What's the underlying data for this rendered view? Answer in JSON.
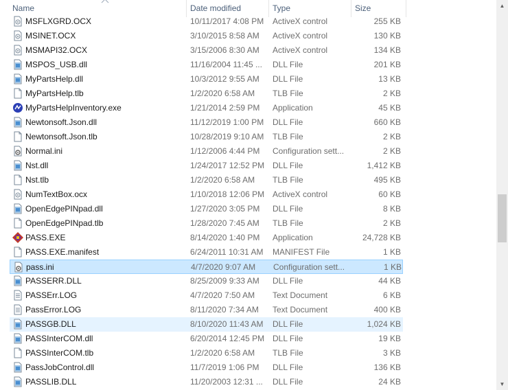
{
  "columns": {
    "name": "Name",
    "date_modified": "Date modified",
    "type": "Type",
    "size": "Size"
  },
  "files": [
    {
      "name": "MSFLXGRD.OCX",
      "date": "10/11/2017 4:08 PM",
      "type": "ActiveX control",
      "size": "255 KB",
      "icon": "ocx-file-icon"
    },
    {
      "name": "MSINET.OCX",
      "date": "3/10/2015 8:58 AM",
      "type": "ActiveX control",
      "size": "130 KB",
      "icon": "ocx-file-icon"
    },
    {
      "name": "MSMAPI32.OCX",
      "date": "3/15/2006 8:30 AM",
      "type": "ActiveX control",
      "size": "134 KB",
      "icon": "ocx-file-icon"
    },
    {
      "name": "MSPOS_USB.dll",
      "date": "11/16/2004 11:45 ...",
      "type": "DLL File",
      "size": "201 KB",
      "icon": "dll-file-icon"
    },
    {
      "name": "MyPartsHelp.dll",
      "date": "10/3/2012 9:55 AM",
      "type": "DLL File",
      "size": "13 KB",
      "icon": "dll-file-icon"
    },
    {
      "name": "MyPartsHelp.tlb",
      "date": "1/2/2020 6:58 AM",
      "type": "TLB File",
      "size": "2 KB",
      "icon": "blank-file-icon"
    },
    {
      "name": "MyPartsHelpInventory.exe",
      "date": "1/21/2014 2:59 PM",
      "type": "Application",
      "size": "45 KB",
      "icon": "app-exe-icon"
    },
    {
      "name": "Newtonsoft.Json.dll",
      "date": "11/12/2019 1:00 PM",
      "type": "DLL File",
      "size": "660 KB",
      "icon": "dll-file-icon"
    },
    {
      "name": "Newtonsoft.Json.tlb",
      "date": "10/28/2019 9:10 AM",
      "type": "TLB File",
      "size": "2 KB",
      "icon": "blank-file-icon"
    },
    {
      "name": "Normal.ini",
      "date": "1/12/2006 4:44 PM",
      "type": "Configuration sett...",
      "size": "2 KB",
      "icon": "ini-file-icon"
    },
    {
      "name": "Nst.dll",
      "date": "1/24/2017 12:52 PM",
      "type": "DLL File",
      "size": "1,412 KB",
      "icon": "dll-file-icon"
    },
    {
      "name": "Nst.tlb",
      "date": "1/2/2020 6:58 AM",
      "type": "TLB File",
      "size": "495 KB",
      "icon": "blank-file-icon"
    },
    {
      "name": "NumTextBox.ocx",
      "date": "1/10/2018 12:06 PM",
      "type": "ActiveX control",
      "size": "60 KB",
      "icon": "ocx-file-icon"
    },
    {
      "name": "OpenEdgePINpad.dll",
      "date": "1/27/2020 3:05 PM",
      "type": "DLL File",
      "size": "8 KB",
      "icon": "dll-file-icon"
    },
    {
      "name": "OpenEdgePINpad.tlb",
      "date": "1/28/2020 7:45 AM",
      "type": "TLB File",
      "size": "2 KB",
      "icon": "blank-file-icon"
    },
    {
      "name": "PASS.EXE",
      "date": "8/14/2020 1:40 PM",
      "type": "Application",
      "size": "24,728 KB",
      "icon": "pass-app-icon"
    },
    {
      "name": "PASS.EXE.manifest",
      "date": "6/24/2011 10:31 AM",
      "type": "MANIFEST File",
      "size": "1 KB",
      "icon": "blank-file-icon"
    },
    {
      "name": "pass.ini",
      "date": "4/7/2020 9:07 AM",
      "type": "Configuration sett...",
      "size": "1 KB",
      "icon": "ini-file-icon"
    },
    {
      "name": "PASSERR.DLL",
      "date": "8/25/2009 9:33 AM",
      "type": "DLL File",
      "size": "44 KB",
      "icon": "dll-file-icon"
    },
    {
      "name": "PASSErr.LOG",
      "date": "4/7/2020 7:50 AM",
      "type": "Text Document",
      "size": "6 KB",
      "icon": "text-file-icon"
    },
    {
      "name": "PassError.LOG",
      "date": "8/11/2020 7:34 AM",
      "type": "Text Document",
      "size": "400 KB",
      "icon": "text-file-icon"
    },
    {
      "name": "PASSGB.DLL",
      "date": "8/10/2020 11:43 AM",
      "type": "DLL File",
      "size": "1,024 KB",
      "icon": "dll-file-icon"
    },
    {
      "name": "PASSInterCOM.dll",
      "date": "6/20/2014 12:45 PM",
      "type": "DLL File",
      "size": "19 KB",
      "icon": "dll-file-icon"
    },
    {
      "name": "PASSInterCOM.tlb",
      "date": "1/2/2020 6:58 AM",
      "type": "TLB File",
      "size": "3 KB",
      "icon": "blank-file-icon"
    },
    {
      "name": "PassJobControl.dll",
      "date": "11/7/2019 1:06 PM",
      "type": "DLL File",
      "size": "136 KB",
      "icon": "dll-file-icon"
    },
    {
      "name": "PASSLIB.DLL",
      "date": "11/20/2003 12:31 ...",
      "type": "DLL File",
      "size": "24 KB",
      "icon": "dll-file-icon"
    }
  ],
  "selected_file": "pass.ini",
  "hovered_file": "PASSGB.DLL",
  "colors": {
    "selected_bg": "#cce8ff",
    "hover_bg": "#e5f3ff",
    "highlight": "#d7f246",
    "header_text": "#4c607a"
  }
}
